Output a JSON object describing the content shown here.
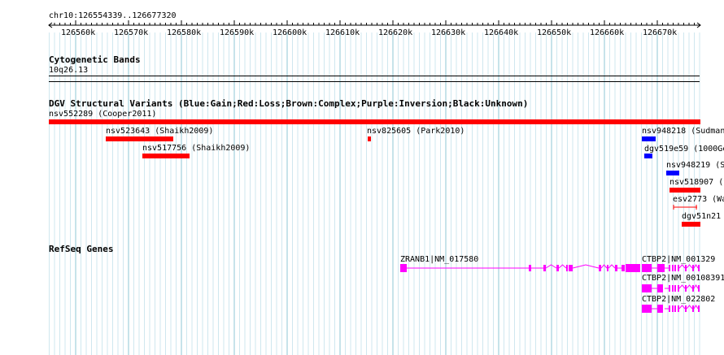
{
  "ruler": {
    "range_label": "chr10:126554339..126677320",
    "ticks": [
      "126560k",
      "126570k",
      "126580k",
      "126590k",
      "126600k",
      "126610k",
      "126620k",
      "126630k",
      "126640k",
      "126650k",
      "126660k",
      "126670k"
    ]
  },
  "cytoband": {
    "title": "Cytogenetic Bands",
    "band": "10q26.13"
  },
  "dgv": {
    "title": "DGV Structural Variants (Blue:Gain;Red:Loss;Brown:Complex;Purple:Inversion;Black:Unknown)",
    "features": [
      {
        "label": "nsv552289 (Cooper2011)",
        "color": "#ff0000"
      },
      {
        "label": "nsv523643 (Shaikh2009)",
        "color": "#ff0000"
      },
      {
        "label": "nsv517756 (Shaikh2009)",
        "color": "#ff0000"
      },
      {
        "label": "nsv825605 (Park2010)",
        "color": "#ff0000"
      },
      {
        "label": "nsv948218 (Sudman",
        "color": "#0000ff"
      },
      {
        "label": "dgv519e59 (1000Ge",
        "color": "#0000ff"
      },
      {
        "label": "nsv948219 (S",
        "color": "#0000ff"
      },
      {
        "label": "nsv518907 (S",
        "color": "#ff0000"
      },
      {
        "label": "esv2773 (Wa",
        "color": "#ff0000"
      },
      {
        "label": "dgv51n21",
        "color": "#ff0000"
      }
    ]
  },
  "refseq": {
    "title": "RefSeq Genes",
    "genes": [
      {
        "label": "ZRANB1|NM_017580",
        "color": "#ff00ff"
      },
      {
        "label": "CTBP2|NM_001329",
        "color": "#ff00ff"
      },
      {
        "label": "CTBP2|NM_00108391",
        "color": "#ff00ff"
      },
      {
        "label": "CTBP2|NM_022802",
        "color": "#ff00ff"
      }
    ]
  },
  "colors": {
    "grid_major": "#8fc7d6",
    "grid_minor": "#cfe7ef",
    "loss": "#ff0000",
    "gain": "#0000ff",
    "gene": "#ff00ff"
  }
}
